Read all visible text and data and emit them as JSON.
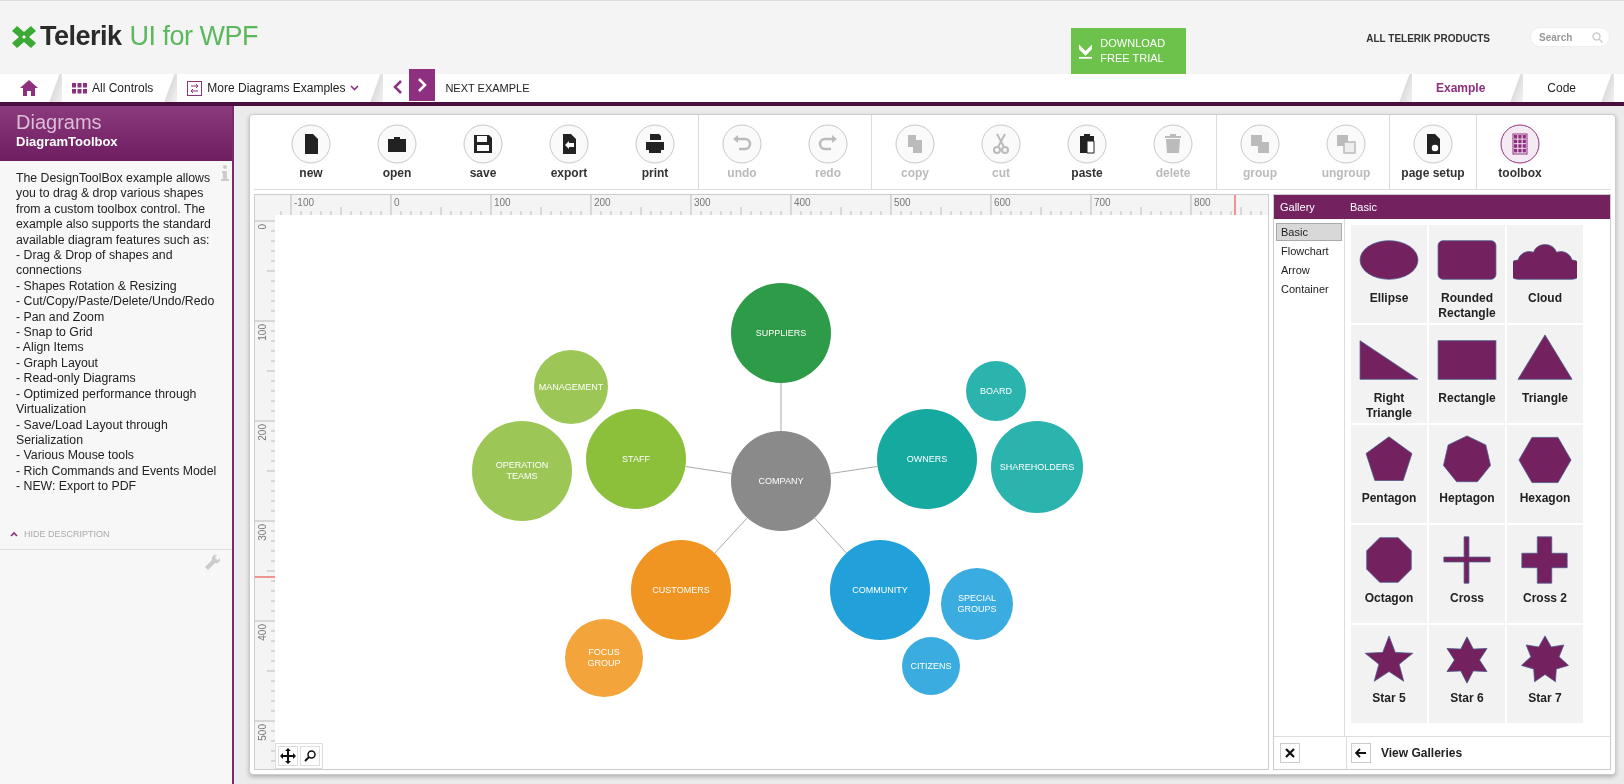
{
  "header": {
    "brand": "Telerik",
    "product": "UI for WPF",
    "download_button": "DOWNLOAD FREE TRIAL",
    "all_products": "ALL TELERIK PRODUCTS",
    "search": {
      "placeholder": "Search"
    }
  },
  "nav": {
    "items": [
      {
        "label": "All Controls"
      },
      {
        "label": "More Diagrams Examples"
      }
    ],
    "next_label": "NEXT EXAMPLE",
    "view_tabs": [
      {
        "label": "Example",
        "selected": true
      },
      {
        "label": "Code",
        "selected": false
      }
    ]
  },
  "sidebar": {
    "title": "Diagrams",
    "subtitle": "DiagramToolbox",
    "intro": "The DesignToolBox example allows you to drag & drop various shapes from a custom toolbox control. The example also supports the standard available diagram features such as:",
    "features": [
      "- Drag & Drop of shapes and connections",
      "- Shapes Rotation & Resizing",
      "- Cut/Copy/Paste/Delete/Undo/Redo",
      "- Pan and Zoom",
      "- Snap to Grid",
      "- Align Items",
      "- Graph Layout",
      "- Read-only Diagrams",
      "- Optimized performance through Virtualization",
      "- Save/Load Layout through Serialization",
      "- Various Mouse tools",
      "- Rich Commands and Events Model",
      "- NEW: Export to PDF"
    ],
    "hide_label": "HIDE DESCRIPTION"
  },
  "toolbar": {
    "groups": [
      [
        {
          "label": "new",
          "disabled": false,
          "selected": false
        },
        {
          "label": "open",
          "disabled": false,
          "selected": false
        },
        {
          "label": "save",
          "disabled": false,
          "selected": false
        },
        {
          "label": "export",
          "disabled": false,
          "selected": false
        },
        {
          "label": "print",
          "disabled": false,
          "selected": false
        }
      ],
      [
        {
          "label": "undo",
          "disabled": true,
          "selected": false
        },
        {
          "label": "redo",
          "disabled": true,
          "selected": false
        }
      ],
      [
        {
          "label": "copy",
          "disabled": true,
          "selected": false
        },
        {
          "label": "cut",
          "disabled": true,
          "selected": false
        },
        {
          "label": "paste",
          "disabled": false,
          "selected": false
        },
        {
          "label": "delete",
          "disabled": true,
          "selected": false
        }
      ],
      [
        {
          "label": "group",
          "disabled": true,
          "selected": false
        },
        {
          "label": "ungroup",
          "disabled": true,
          "selected": false
        }
      ],
      [
        {
          "label": "page setup",
          "disabled": false,
          "selected": false
        }
      ],
      [
        {
          "label": "toolbox",
          "disabled": false,
          "selected": true
        }
      ]
    ]
  },
  "ruler": {
    "x_labels": [
      "-100",
      "0",
      "100",
      "200",
      "300",
      "400",
      "500",
      "600",
      "700",
      "800"
    ],
    "y_labels": [
      "0",
      "100",
      "200",
      "300",
      "400",
      "500"
    ]
  },
  "diagram": {
    "center": {
      "label": "COMPANY",
      "color": "#8a8a8a"
    },
    "branches": [
      {
        "label": "SUPPLIERS",
        "color": "#2e9b48"
      },
      {
        "label": "STAFF",
        "color": "#8cbf3a",
        "satellites": [
          {
            "label": "MANAGEMENT",
            "color": "#9cc756"
          },
          {
            "label": "OPERATION TEAMS",
            "color": "#9cc756"
          }
        ]
      },
      {
        "label": "OWNERS",
        "color": "#16a9a0",
        "satellites": [
          {
            "label": "BOARD",
            "color": "#2bb3ad"
          },
          {
            "label": "SHAREHOLDERS",
            "color": "#2bb3ad"
          }
        ]
      },
      {
        "label": "CUSTOMERS",
        "color": "#f09422",
        "satellites": [
          {
            "label": "FOCUS GROUP",
            "color": "#f3a43b"
          }
        ]
      },
      {
        "label": "COMMUNITY",
        "color": "#22a0da",
        "satellites": [
          {
            "label": "SPECIAL GROUPS",
            "color": "#3aace0"
          },
          {
            "label": "CITIZENS",
            "color": "#3aace0"
          }
        ]
      }
    ]
  },
  "gallery": {
    "title": "Gallery",
    "current": "Basic",
    "categories": [
      {
        "label": "Basic",
        "selected": true
      },
      {
        "label": "Flowchart",
        "selected": false
      },
      {
        "label": "Arrow",
        "selected": false
      },
      {
        "label": "Container",
        "selected": false
      }
    ],
    "shapes": [
      {
        "label": "Ellipse"
      },
      {
        "label": "Rounded Rectangle"
      },
      {
        "label": "Cloud"
      },
      {
        "label": "Right Triangle"
      },
      {
        "label": "Rectangle"
      },
      {
        "label": "Triangle"
      },
      {
        "label": "Pentagon"
      },
      {
        "label": "Heptagon"
      },
      {
        "label": "Hexagon"
      },
      {
        "label": "Octagon"
      },
      {
        "label": "Cross"
      },
      {
        "label": "Cross 2"
      },
      {
        "label": "Star 5"
      },
      {
        "label": "Star 6"
      },
      {
        "label": "Star 7"
      }
    ],
    "back_label": "View Galleries"
  }
}
